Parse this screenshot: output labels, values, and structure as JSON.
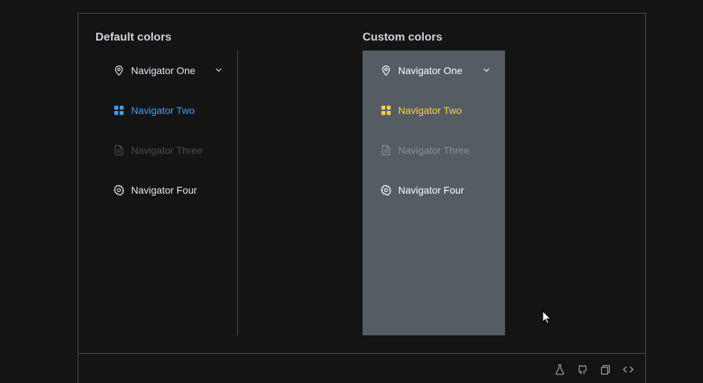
{
  "colors": {
    "page_bg": "#141414",
    "border": "#4c4d4f",
    "default_text": "#e5eaf3",
    "default_active": "#409eff",
    "disabled": "#4c4d4f",
    "custom_bg": "#545c64",
    "custom_text": "#ffffff",
    "custom_active": "#ffd04b",
    "custom_disabled": "#8d9095"
  },
  "default_section": {
    "title": "Default colors",
    "items": [
      {
        "label": "Navigator One",
        "icon": "location-icon",
        "state": "normal",
        "submenu": true
      },
      {
        "label": "Navigator Two",
        "icon": "menu-grid-icon",
        "state": "active",
        "submenu": false
      },
      {
        "label": "Navigator Three",
        "icon": "document-icon",
        "state": "disabled",
        "submenu": false
      },
      {
        "label": "Navigator Four",
        "icon": "setting-icon",
        "state": "normal",
        "submenu": false
      }
    ]
  },
  "custom_section": {
    "title": "Custom colors",
    "items": [
      {
        "label": "Navigator One",
        "icon": "location-icon",
        "state": "normal",
        "submenu": true
      },
      {
        "label": "Navigator Two",
        "icon": "menu-grid-icon",
        "state": "active",
        "submenu": false
      },
      {
        "label": "Navigator Three",
        "icon": "document-icon",
        "state": "disabled",
        "submenu": false
      },
      {
        "label": "Navigator Four",
        "icon": "setting-icon",
        "state": "normal",
        "submenu": false
      }
    ]
  },
  "footer_icons": [
    "playground-flask-icon",
    "github-icon",
    "copy-icon",
    "code-icon"
  ]
}
